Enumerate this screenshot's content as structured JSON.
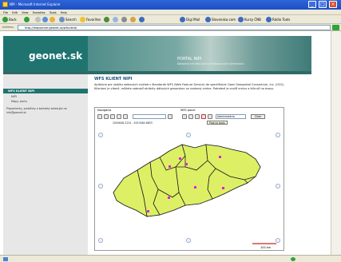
{
  "window": {
    "title": "NPI - Microsoft Internet Explorer"
  },
  "menu": [
    "File",
    "Edit",
    "View",
    "Favorites",
    "Tools",
    "Help"
  ],
  "toolbar": {
    "back": "Back",
    "search": "Search",
    "favorites": "Favorites",
    "links": [
      "Digi Mail",
      "Slovenska.com",
      "Kurzy ČNB",
      "Rádio Tools"
    ]
  },
  "address": {
    "label": "Address",
    "url": "http://mapserver.geonet.sk/wfsclient/"
  },
  "header": {
    "logo": "geonet.sk",
    "portal": "PORTAL NIPI",
    "subtitle": "Národná infraštruktúra Priestorových Informácií"
  },
  "sidebar": {
    "active": "WFS KLIENT NIPI",
    "items": [
      "NIPI",
      "Mapy portu"
    ],
    "note": "Pripomienky, problémy a kontakty adresujte na info@geonet.sk"
  },
  "content": {
    "title": "WFS KLIENT NIPI",
    "para1": "Aplikácia pre ukážku webových služieb v štandarde WFS (Web Feature Service) de specifikácie Open Geospatial Consortium, Inc. (OGC).",
    "para2": "Klientovi je vitané, môžete zobraziť atribúty dátových geoprvkov vo zvolenej vrstve. Potrebné je zvoliť vrstvu a kliknúť na mapu."
  },
  "map": {
    "nav_label": "Navigácia",
    "wfs_label": "WFS panel",
    "coords": "2000848.2224 - 4923484.6853",
    "layer_select": "Administrácia",
    "tooltip": "Pozícia bodu",
    "clear_button": "Clear",
    "scale_label": "100 km"
  },
  "colors": {
    "accent": "#1f7470",
    "region_fill": "#ddf065",
    "point": "#e020d8"
  }
}
